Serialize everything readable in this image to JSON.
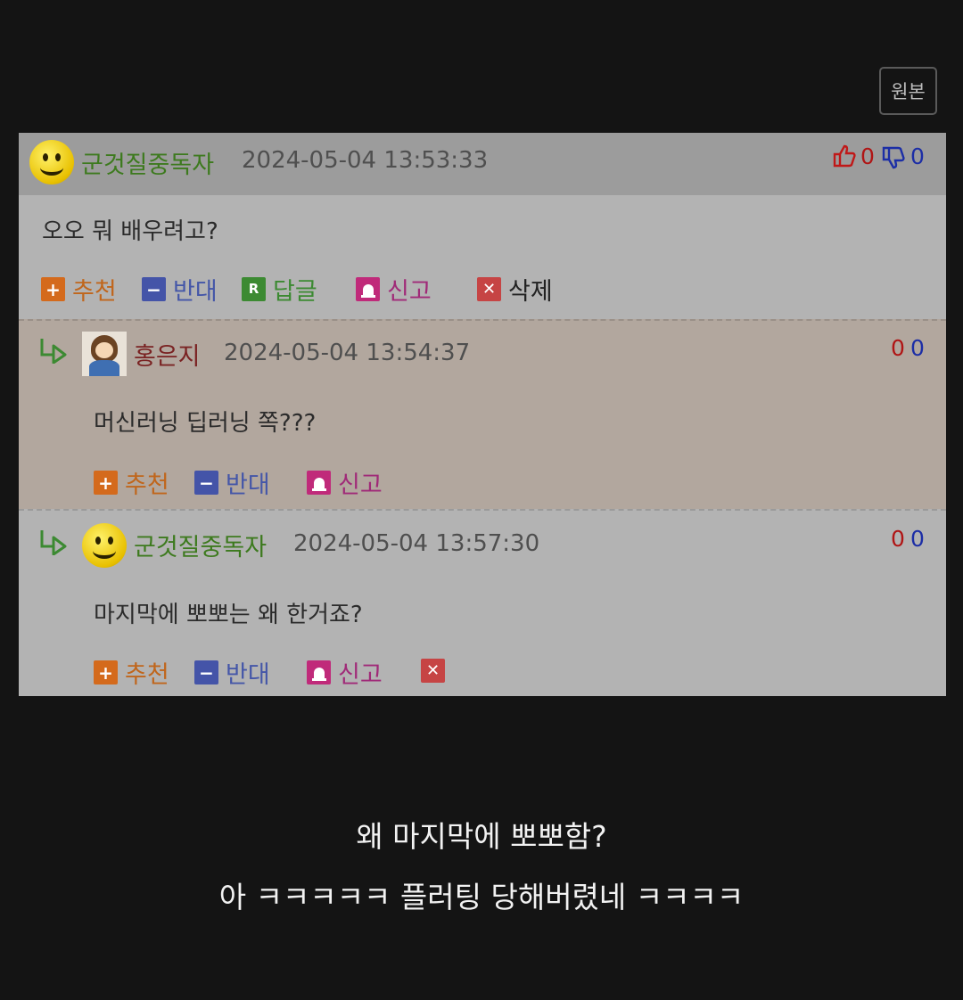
{
  "original_button": "원본",
  "comments": [
    {
      "nickname": "군것질중독자",
      "datetime": "2024-05-04 13:53:33",
      "up": "0",
      "down": "0",
      "content": "오오 뭐 배우려고?",
      "actions": {
        "recommend": "추천",
        "oppose": "반대",
        "reply": "답글",
        "report": "신고",
        "delete": "삭제"
      }
    },
    {
      "nickname": "홍은지",
      "datetime": "2024-05-04 13:54:37",
      "up": "0",
      "down": "0",
      "content": "머신러닝 딥러닝 쪽???",
      "actions": {
        "recommend": "추천",
        "oppose": "반대",
        "report": "신고"
      }
    },
    {
      "nickname": "군것질중독자",
      "datetime": "2024-05-04 13:57:30",
      "up": "0",
      "down": "0",
      "content": "마지막에 뽀뽀는 왜 한거죠?",
      "actions": {
        "recommend": "추천",
        "oppose": "반대",
        "report": "신고"
      }
    }
  ],
  "captions": [
    "왜 마지막에 뽀뽀함?",
    "아 ㅋㅋㅋㅋㅋ 플러팅 당해버렸네 ㅋㅋㅋㅋ"
  ],
  "colors": {
    "background": "#141414",
    "nickname_green": "#3d7a1e",
    "nickname_red": "#7a2323",
    "reply_highlight": "#b2a79e"
  }
}
